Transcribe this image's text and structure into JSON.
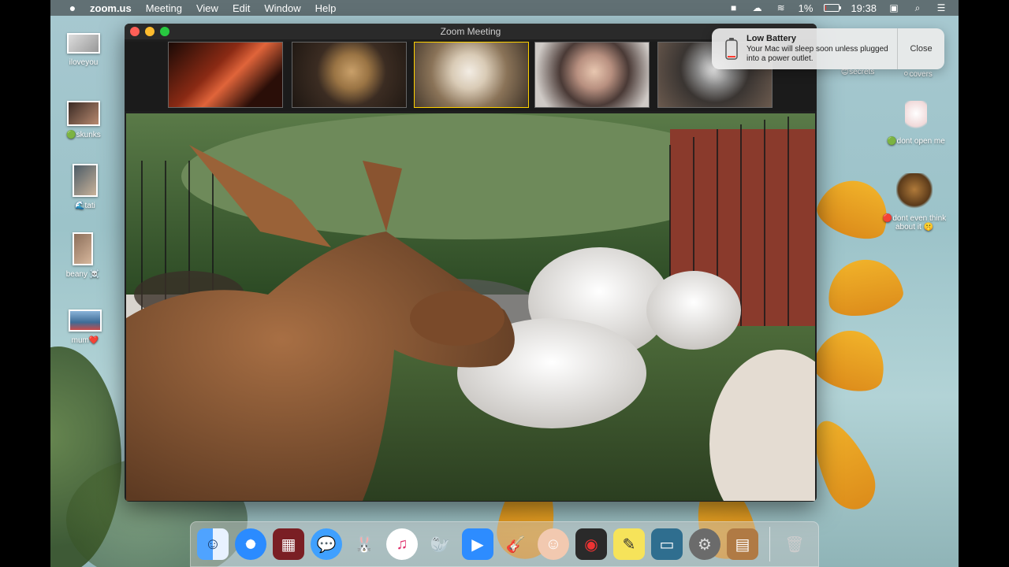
{
  "menubar": {
    "apple_icon": "apple-logo-icon",
    "app_name": "zoom.us",
    "menus": [
      "Meeting",
      "View",
      "Edit",
      "Window",
      "Help"
    ],
    "battery_percent": "1%",
    "battery_level": 0.01,
    "time": "19:38",
    "status_icons": [
      "zoom-status-icon",
      "creative-cloud-icon",
      "wifi-icon",
      "battery-icon",
      "screen-mirror-icon",
      "spotlight-search-icon",
      "control-list-icon"
    ]
  },
  "desktop": {
    "icons_left": [
      {
        "label": "iloveyou",
        "prefix": ""
      },
      {
        "label": "skunks",
        "prefix": "🟢"
      },
      {
        "label": "tati",
        "prefix": "🌊"
      },
      {
        "label": "beany ☠️",
        "prefix": ""
      },
      {
        "label": "mum❤️",
        "prefix": ""
      }
    ],
    "icons_right": [
      {
        "label": "secrets",
        "prefix": "😊"
      },
      {
        "label": "covers",
        "prefix": "⚪"
      },
      {
        "label": "dont open me",
        "prefix": "🟢"
      },
      {
        "label": "dont even think about it 🤫",
        "prefix": "🔴"
      }
    ],
    "colors": {
      "wallpaper_sky": "#a7c8d0",
      "sunflower": "#f4b021"
    }
  },
  "zoom_window": {
    "title": "Zoom Meeting",
    "gallery_tiles": [
      {
        "description_icon": "participant-red-tile"
      },
      {
        "description_icon": "participant-doodle-dog-tile"
      },
      {
        "description_icon": "participant-terrier-dog-tile"
      },
      {
        "description_icon": "participant-woman-tile"
      },
      {
        "description_icon": "participant-husky-dog-tile"
      }
    ],
    "active_tile_color": "#ffd200"
  },
  "notification": {
    "title": "Low Battery",
    "body": "Your Mac will sleep soon unless plugged into a power outlet.",
    "close_label": "Close"
  },
  "dock": {
    "items": [
      "finder-icon",
      "safari-icon",
      "photo-booth-icon",
      "messages-icon",
      "character-app-icon",
      "itunes-icon",
      "sequel-pro-icon",
      "zoom-icon",
      "garageband-icon",
      "avatar-app-icon",
      "photo-booth-mirror-icon",
      "stickies-icon",
      "preview-icon",
      "system-preferences-icon",
      "notebook-icon",
      "trash-icon"
    ]
  }
}
